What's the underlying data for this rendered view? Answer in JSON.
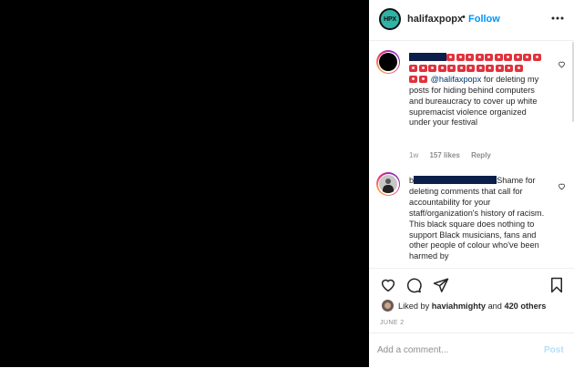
{
  "post": {
    "account": {
      "logo_text": "HPX",
      "username": "halifaxpopx",
      "separator": "•",
      "follow_label": "Follow"
    },
    "comments": [
      {
        "emoji_row_1_count": 10,
        "emoji_row_2_count": 12,
        "emoji_row_3_count": 2,
        "mention": "@halifaxpopx",
        "text": " for deleting my posts for hiding behind computers and bureaucracy to cover up white supremacist violence organized under your festival",
        "time": "1w",
        "likes": "157 likes",
        "reply_label": "Reply"
      },
      {
        "username_start": "b",
        "text": "Shame for deleting comments that call for accountability for your staff/organization's history of racism. This black square does nothing to support Black musicians, fans and other people of colour who've been harmed by"
      }
    ],
    "liked_by": {
      "prefix": "Liked by ",
      "user": "haviahmighty",
      "joiner": " and ",
      "others": "420 others"
    },
    "date": "JUNE 2",
    "add_comment": {
      "placeholder": "Add a comment...",
      "post_label": "Post"
    },
    "colors": {
      "follow": "#0095f6",
      "post_disabled": "#b2dffc",
      "media_background": "#000000",
      "redaction": "#0b1f4a",
      "emoji": "#e0323c"
    }
  }
}
